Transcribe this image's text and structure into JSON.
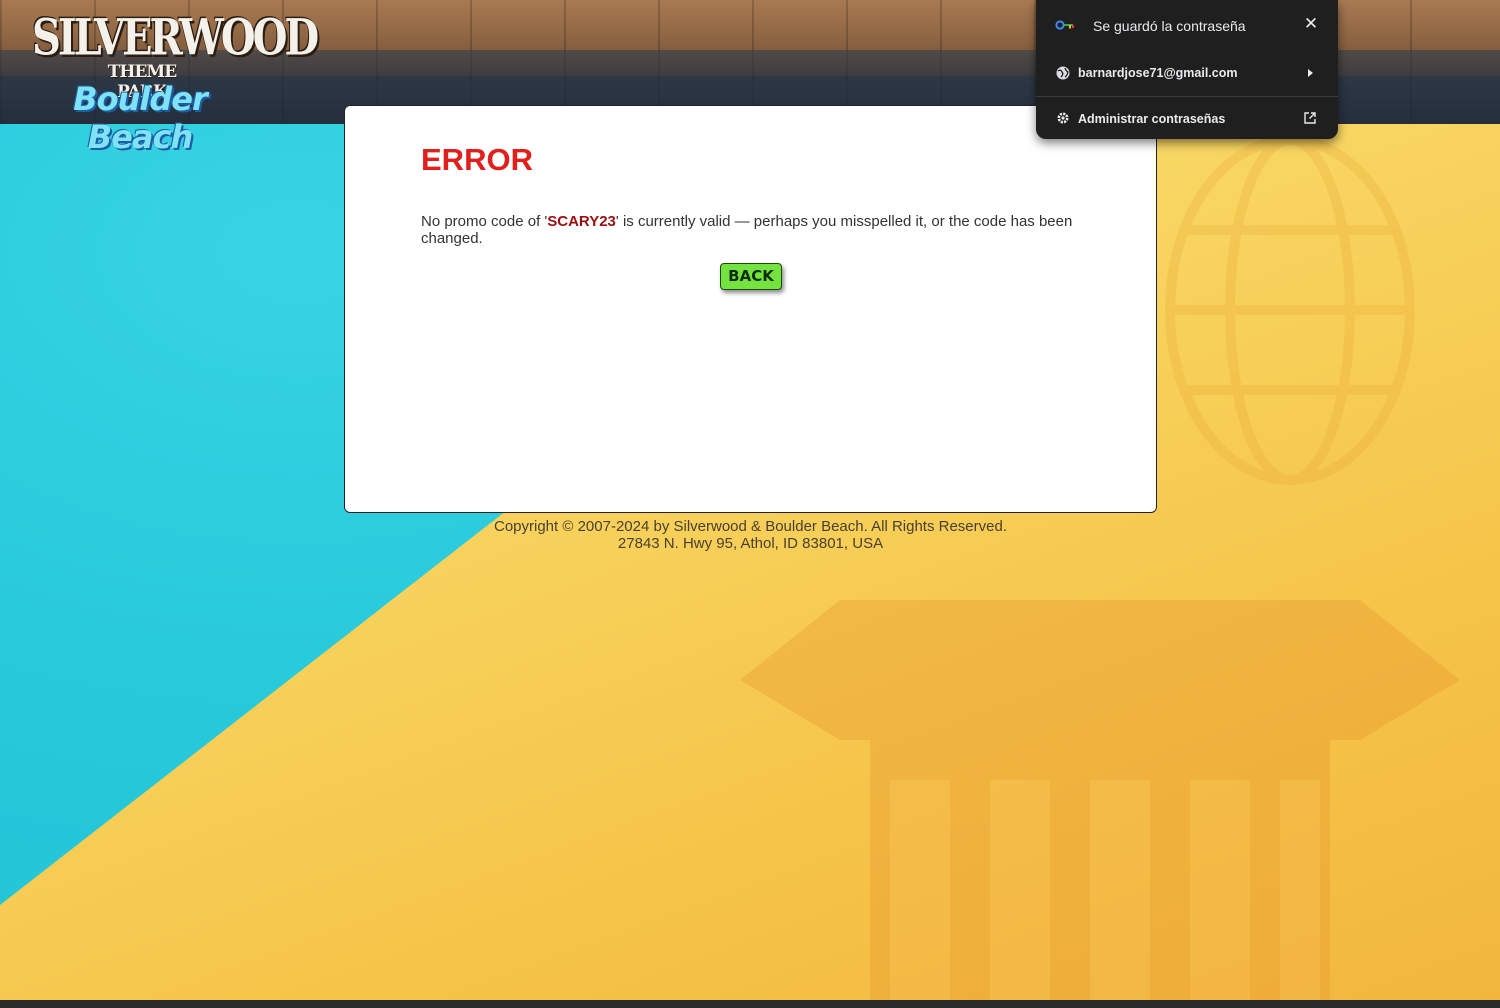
{
  "brand": {
    "logo_line1": "SILVERWOOD",
    "logo_line2": "THEME PARK",
    "logo_line3": "Boulder Beach"
  },
  "error": {
    "title": "ERROR",
    "message_prefix": "No promo code of '",
    "promo_code": "SCARY23",
    "message_suffix": "' is currently valid — perhaps you misspelled it, or the code has been changed.",
    "back_label": "BACK"
  },
  "footer": {
    "copyright": "Copyright © 2007-2024 by Silverwood & Boulder Beach. All Rights Reserved.",
    "address": "27843 N. Hwy 95, Athol, ID 83801, USA"
  },
  "password_popup": {
    "title": "Se guardó la contraseña",
    "account": "barnardjose71@gmail.com",
    "manage_label": "Administrar contraseñas",
    "close_glyph": "✕"
  },
  "colors": {
    "error_red": "#e0201c",
    "promo_code_red": "#9a1010",
    "back_green": "#74e33f",
    "popup_bg": "#1f1f1f"
  }
}
